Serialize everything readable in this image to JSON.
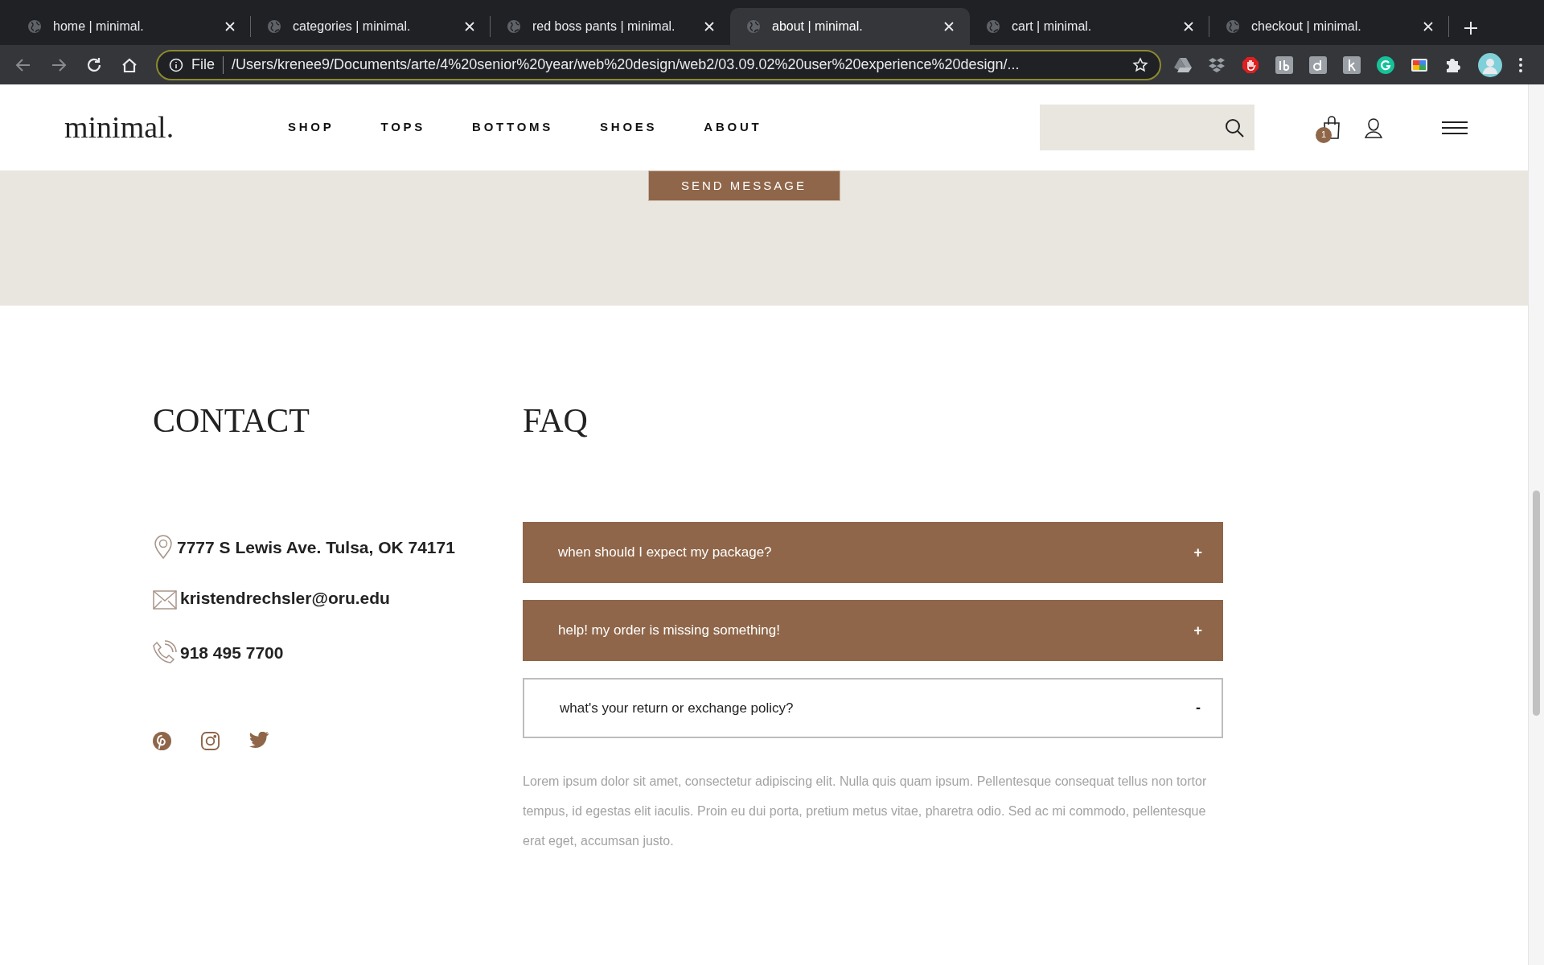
{
  "browser": {
    "tabs": [
      {
        "title": "home | minimal.",
        "selected": false
      },
      {
        "title": "categories | minimal.",
        "selected": false
      },
      {
        "title": "red boss pants | minimal.",
        "selected": false
      },
      {
        "title": "about | minimal.",
        "selected": true
      },
      {
        "title": "cart | minimal.",
        "selected": false
      },
      {
        "title": "checkout | minimal.",
        "selected": false
      }
    ],
    "address_scheme": "File",
    "address": "/Users/krenee9/Documents/arte/4%20senior%20year/web%20design/web2/03.09.02%20user%20experience%20design/..."
  },
  "header": {
    "logo": "minimal.",
    "nav": [
      "SHOP",
      "TOPS",
      "BOTTOMS",
      "SHOES",
      "ABOUT"
    ],
    "cart_count": "1"
  },
  "form": {
    "send_button": "SEND MESSAGE"
  },
  "contact": {
    "heading": "CONTACT",
    "items": [
      {
        "kind": "address",
        "text": "7777 S Lewis Ave. Tulsa, OK 74171"
      },
      {
        "kind": "email",
        "text": "kristendrechsler@oru.edu"
      },
      {
        "kind": "phone",
        "text": "918 495 7700"
      }
    ],
    "social": [
      {
        "kind": "pinterest"
      },
      {
        "kind": "instagram"
      },
      {
        "kind": "twitter"
      }
    ]
  },
  "faq": {
    "heading": "FAQ",
    "items": [
      {
        "question": "when should I expect my package?",
        "expanded": false,
        "toggle": "+"
      },
      {
        "question": "help! my order is missing something!",
        "expanded": false,
        "toggle": "+"
      },
      {
        "question": "what's your return or exchange policy?",
        "expanded": true,
        "toggle": "-",
        "answer": "Lorem ipsum dolor sit amet, consectetur adipiscing elit. Nulla quis quam ipsum. Pellentesque consequat tellus non tortor tempus, id egestas elit iaculis. Proin eu dui porta, pretium metus vitae, pharetra odio. Sed ac mi commodo, pellentesque erat eget, accumsan justo."
      }
    ]
  }
}
